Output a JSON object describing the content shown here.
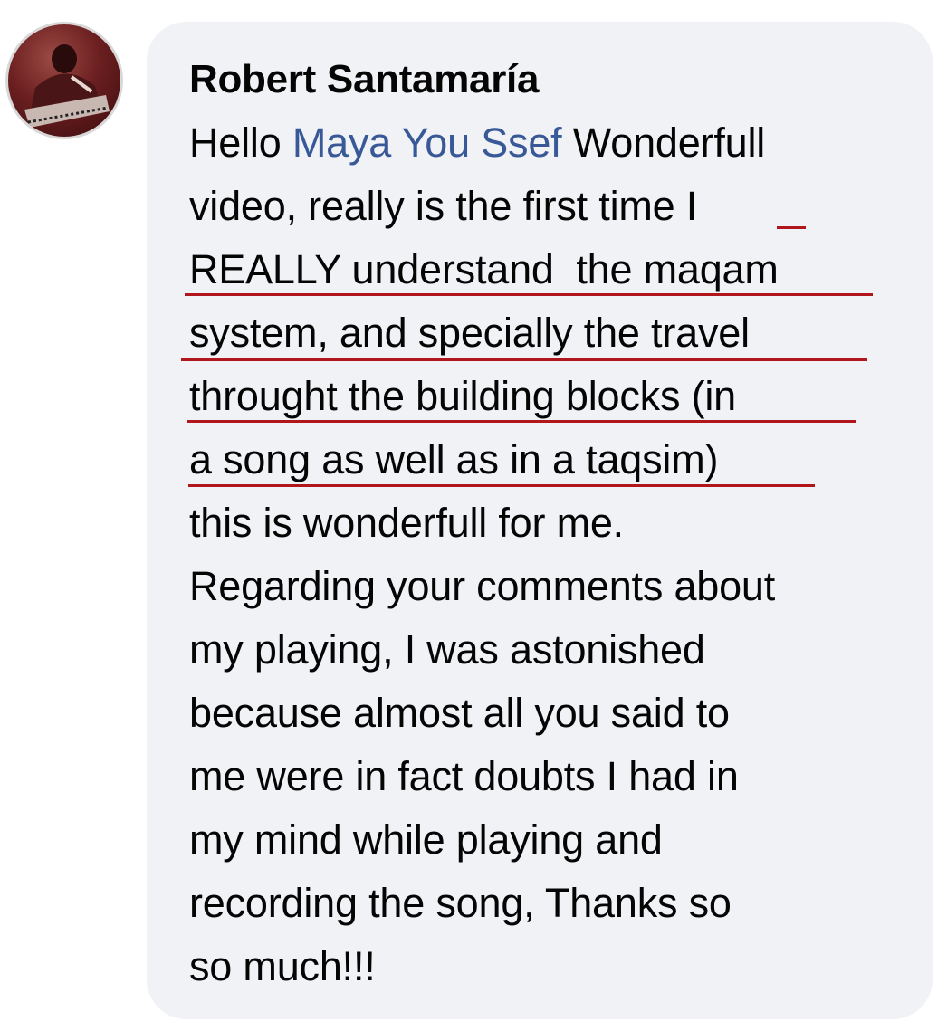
{
  "comment": {
    "author": "Robert Santamaría",
    "avatar_icon": "user-avatar-photo",
    "mention": "Maya You Ssef",
    "lines": {
      "l1_prefix": "Hello ",
      "l1_suffix": " Wonderfull",
      "l2": "video, really is the first time I",
      "l3": "REALLY understand  the maqam",
      "l4": "system, and specially the travel",
      "l5": "throught the building blocks (in",
      "l6": "a song as well as in a taqsim)",
      "l7": "this is wonderfull for me.",
      "l8": "Regarding your comments about",
      "l9": "my playing, I was astonished",
      "l10": "because almost all you said to",
      "l11": "me were in fact doubts I had in",
      "l12": "my mind while playing and",
      "l13": "recording the song, Thanks so",
      "l14": "so much!!!"
    }
  },
  "colors": {
    "bubble": "#f0f2f5",
    "text": "#050505",
    "mention": "#385898",
    "annotation_underline": "#b0161c"
  }
}
